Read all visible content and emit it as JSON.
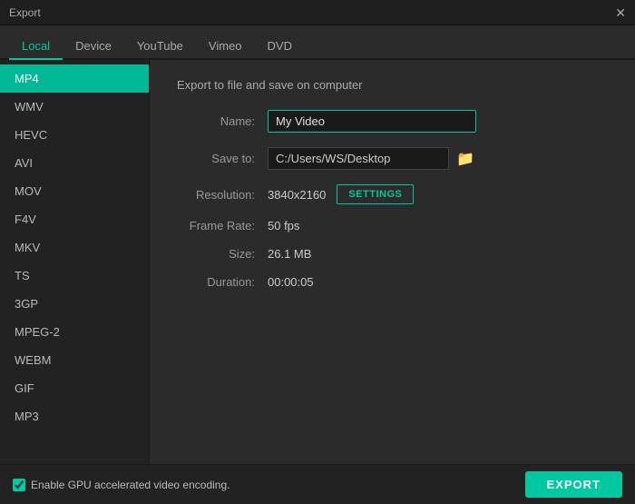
{
  "titlebar": {
    "title": "Export",
    "close_label": "✕"
  },
  "tabs": [
    {
      "id": "local",
      "label": "Local",
      "active": true
    },
    {
      "id": "device",
      "label": "Device",
      "active": false
    },
    {
      "id": "youtube",
      "label": "YouTube",
      "active": false
    },
    {
      "id": "vimeo",
      "label": "Vimeo",
      "active": false
    },
    {
      "id": "dvd",
      "label": "DVD",
      "active": false
    }
  ],
  "sidebar": {
    "items": [
      {
        "id": "mp4",
        "label": "MP4",
        "active": true
      },
      {
        "id": "wmv",
        "label": "WMV",
        "active": false
      },
      {
        "id": "hevc",
        "label": "HEVC",
        "active": false
      },
      {
        "id": "avi",
        "label": "AVI",
        "active": false
      },
      {
        "id": "mov",
        "label": "MOV",
        "active": false
      },
      {
        "id": "f4v",
        "label": "F4V",
        "active": false
      },
      {
        "id": "mkv",
        "label": "MKV",
        "active": false
      },
      {
        "id": "ts",
        "label": "TS",
        "active": false
      },
      {
        "id": "3gp",
        "label": "3GP",
        "active": false
      },
      {
        "id": "mpeg2",
        "label": "MPEG-2",
        "active": false
      },
      {
        "id": "webm",
        "label": "WEBM",
        "active": false
      },
      {
        "id": "gif",
        "label": "GIF",
        "active": false
      },
      {
        "id": "mp3",
        "label": "MP3",
        "active": false
      }
    ]
  },
  "content": {
    "section_title": "Export to file and save on computer",
    "fields": {
      "name_label": "Name:",
      "name_value": "My Video",
      "name_placeholder": "My Video",
      "saveto_label": "Save to:",
      "saveto_value": "C:/Users/WS/Desktop",
      "folder_icon": "📁",
      "resolution_label": "Resolution:",
      "resolution_value": "3840x2160",
      "settings_label": "SETTINGS",
      "framerate_label": "Frame Rate:",
      "framerate_value": "50 fps",
      "size_label": "Size:",
      "size_value": "26.1 MB",
      "duration_label": "Duration:",
      "duration_value": "00:00:05"
    }
  },
  "bottombar": {
    "gpu_label": "Enable GPU accelerated video encoding.",
    "gpu_checked": true,
    "export_label": "EXPORT"
  }
}
